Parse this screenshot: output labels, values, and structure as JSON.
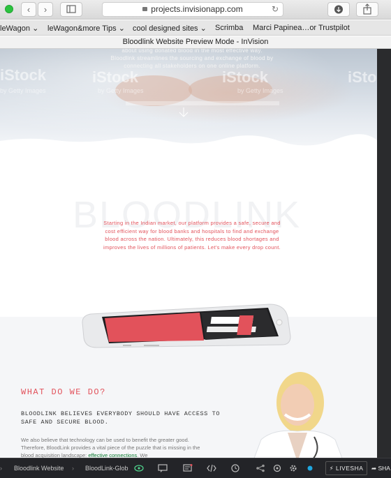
{
  "browser": {
    "address": "projects.invisionapp.com",
    "back_label": "‹",
    "forward_label": "›",
    "bookmarks": [
      "leWagon ⌄",
      "leWagon&more Tips ⌄",
      "cool designed sites ⌄",
      "Scrimba",
      "Marci Papinea…or Trustpilot"
    ],
    "window_title": "Bloodlink Website Preview Mode - InVision"
  },
  "hero": {
    "text_line1": "about using donated blood in the most effective way.",
    "text_line2": "Bloodlink streamlines the sourcing and exchange of blood by",
    "text_line3": "connecting all stakeholders on one online platform.",
    "watermark": "iStock",
    "watermark_sub": "by Getty Images"
  },
  "brand": {
    "background_word": "BLOODLINK",
    "intro": "Starting in the Indian market, our platform provides a safe, secure and cost efficient way for blood banks and hospitals to find and exchange blood across the nation. Ultimately, this reduces blood shortages and improves the lives of millions of patients. Let's make every drop count."
  },
  "what": {
    "title": "WHAT DO WE DO?",
    "subtitle": "BLOODLINK BELIEVES EVERYBODY SHOULD HAVE ACCESS TO SAFE AND SECURE BLOOD.",
    "body": "We also believe that technology can be used to benefit the greater good. Therefore, BloodLink provides a vital piece of the puzzle that is missing in the blood acquisition landscape:",
    "highlight": "effective connections",
    "body_tail": ". We"
  },
  "bottombar": {
    "project": "Bloodlink Website",
    "screen": "BloodLink-Glob",
    "liveshare": "LIVESHA",
    "share": "SHA"
  },
  "colors": {
    "accent": "#e2525b",
    "bottombar": "#232428"
  }
}
